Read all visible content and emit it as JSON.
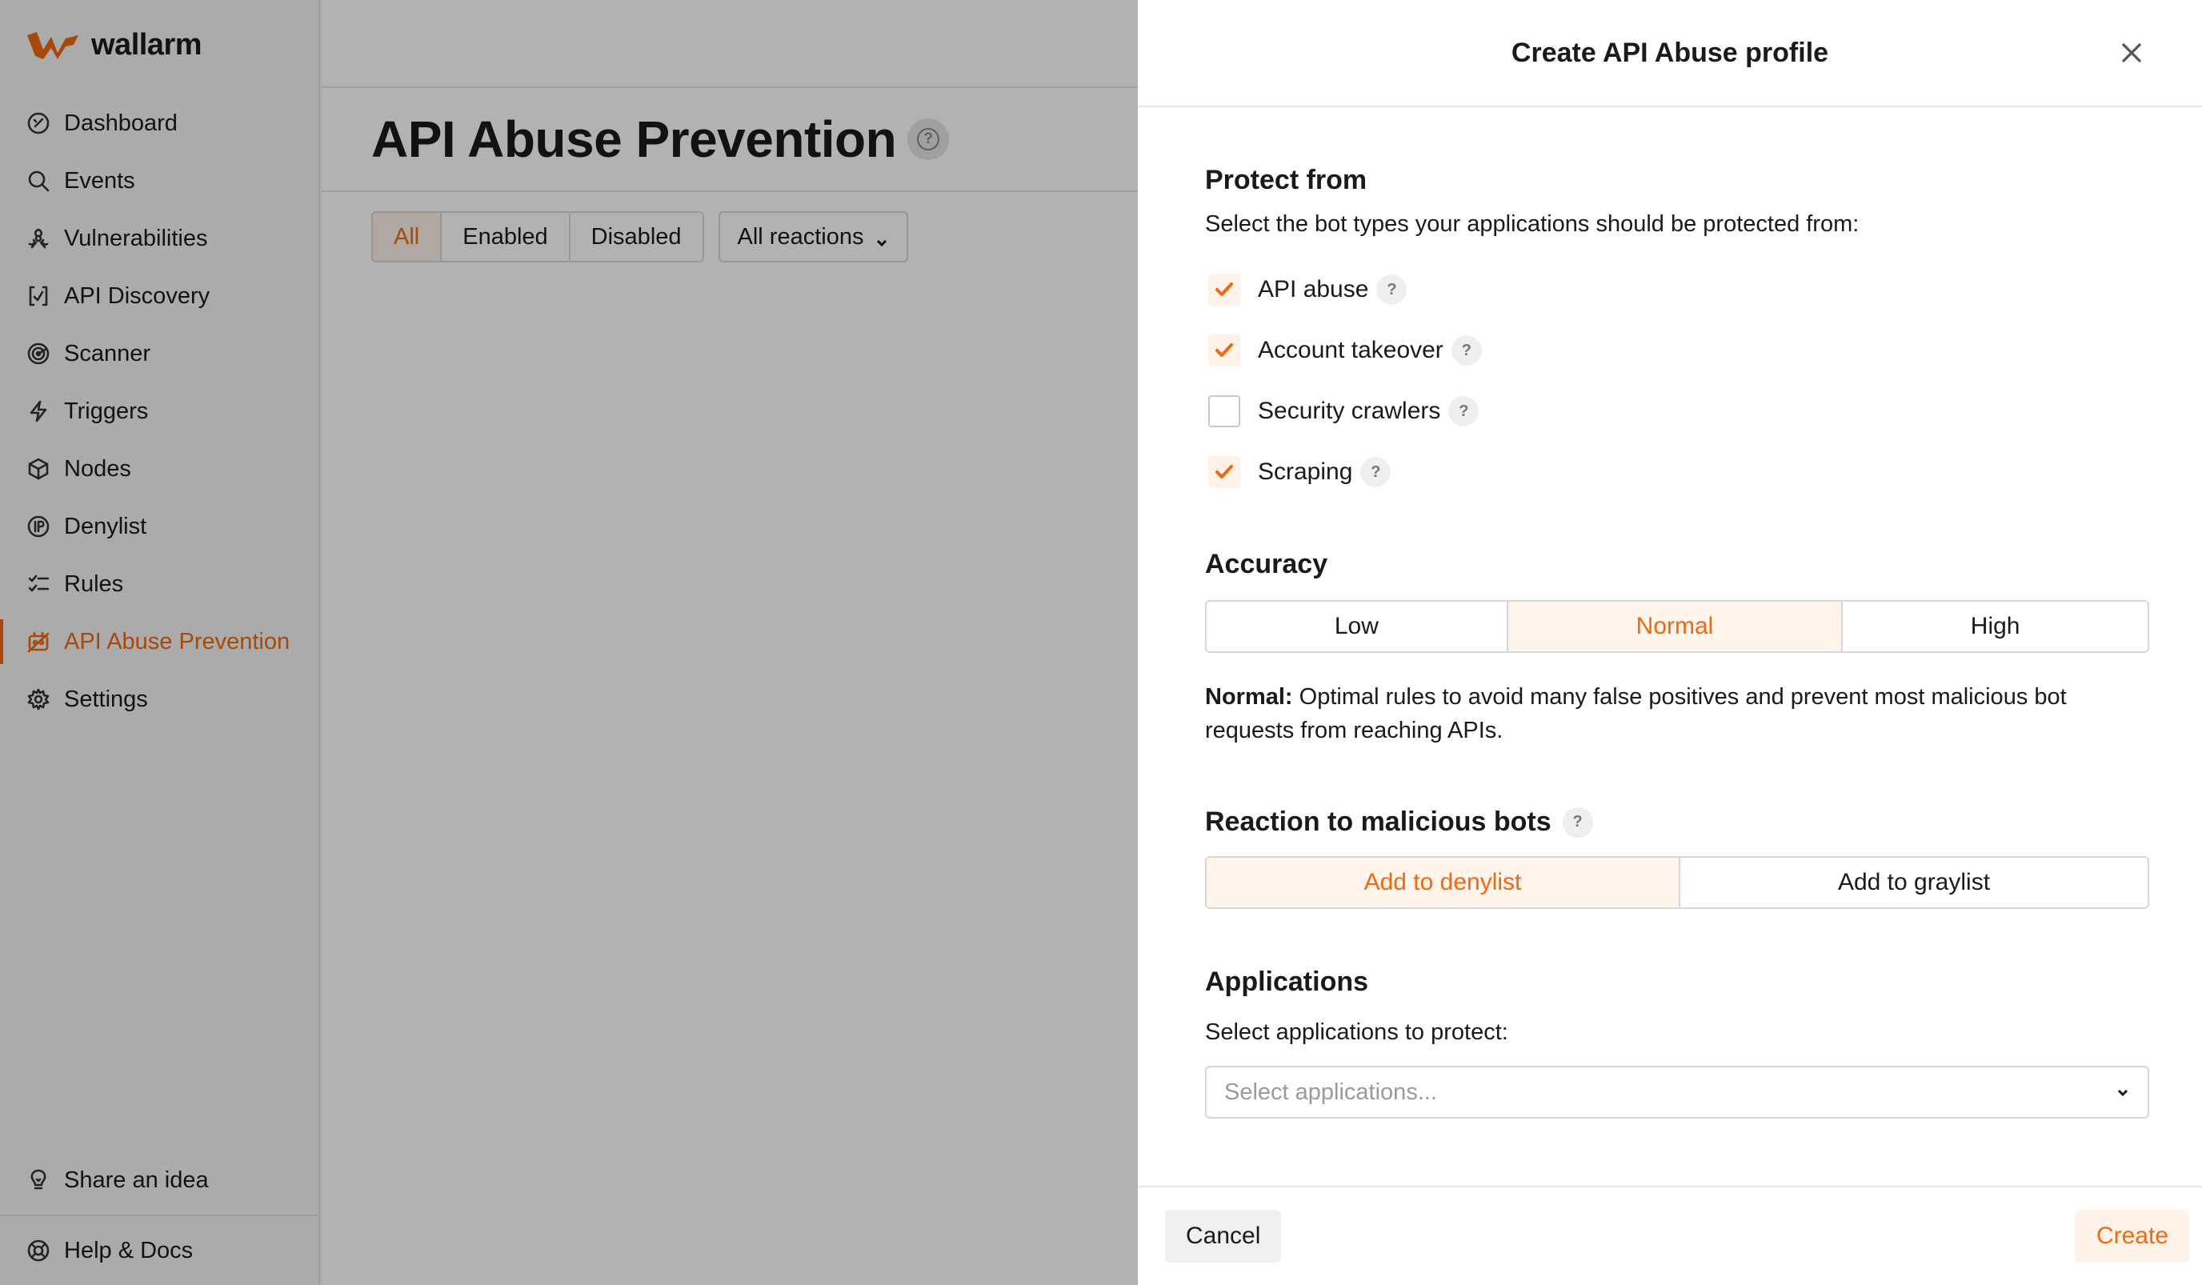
{
  "brand": {
    "name": "wallarm",
    "accent_color": "#ee6a10"
  },
  "sidebar": {
    "items": [
      {
        "label": "Dashboard",
        "icon": "dashboard-icon"
      },
      {
        "label": "Events",
        "icon": "search-icon"
      },
      {
        "label": "Vulnerabilities",
        "icon": "biohazard-icon"
      },
      {
        "label": "API Discovery",
        "icon": "api-discovery-icon"
      },
      {
        "label": "Scanner",
        "icon": "radar-icon"
      },
      {
        "label": "Triggers",
        "icon": "lightning-icon"
      },
      {
        "label": "Nodes",
        "icon": "cube-icon"
      },
      {
        "label": "Denylist",
        "icon": "ip-icon"
      },
      {
        "label": "Rules",
        "icon": "checklist-icon"
      },
      {
        "label": "API Abuse Prevention",
        "icon": "robot-icon",
        "active": true
      },
      {
        "label": "Settings",
        "icon": "gear-icon"
      }
    ],
    "bottom": [
      {
        "label": "Share an idea",
        "icon": "lightbulb-icon"
      },
      {
        "label": "Help & Docs",
        "icon": "lifebuoy-icon"
      }
    ]
  },
  "page": {
    "title": "API Abuse Prevention",
    "status_filters": [
      "All",
      "Enabled",
      "Disabled"
    ],
    "active_status_filter": "All",
    "reactions_filter": "All reactions"
  },
  "drawer": {
    "title": "Create API Abuse profile",
    "protect": {
      "title": "Protect from",
      "desc": "Select the bot types your applications should be protected from:",
      "options": [
        {
          "label": "API abuse",
          "checked": true
        },
        {
          "label": "Account takeover",
          "checked": true
        },
        {
          "label": "Security crawlers",
          "checked": false
        },
        {
          "label": "Scraping",
          "checked": true
        }
      ]
    },
    "accuracy": {
      "title": "Accuracy",
      "options": [
        "Low",
        "Normal",
        "High"
      ],
      "selected": "Normal",
      "desc_label": "Normal:",
      "desc_text": " Optimal rules to avoid many false positives and prevent most malicious bot requests from reaching APIs."
    },
    "reaction": {
      "title": "Reaction to malicious bots",
      "options": [
        "Add to denylist",
        "Add to graylist"
      ],
      "selected": "Add to denylist"
    },
    "applications": {
      "title": "Applications",
      "desc": "Select applications to protect:",
      "placeholder": "Select applications..."
    },
    "footer": {
      "cancel": "Cancel",
      "create": "Create"
    }
  }
}
